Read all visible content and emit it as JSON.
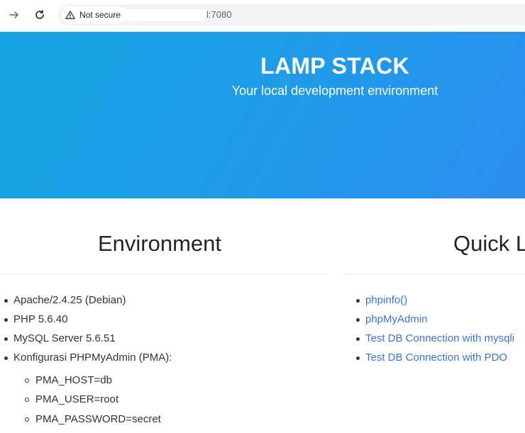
{
  "browser": {
    "security_label": "Not secure",
    "url_suffix": "l:7080",
    "icons": {
      "back": "arrow-right-icon",
      "reload": "reload-icon",
      "warning": "warning-triangle-icon"
    }
  },
  "hero": {
    "title": "LAMP STACK",
    "subtitle": "Your local development environment"
  },
  "environment": {
    "title": "Environment",
    "items": [
      "Apache/2.4.25 (Debian)",
      "PHP 5.6.40",
      "MySQL Server 5.6.51",
      "Konfigurasi PHPMyAdmin (PMA):"
    ],
    "sub_items": [
      "PMA_HOST=db",
      "PMA_USER=root",
      "PMA_PASSWORD=secret"
    ]
  },
  "quick_links": {
    "title": "Quick L",
    "items": [
      "phpinfo()",
      "phpMyAdmin",
      "Test DB Connection with mysqli",
      "Test DB Connection with PDO"
    ]
  },
  "colors": {
    "hero_start": "#15a3e3",
    "hero_end": "#2b8ff0",
    "link": "#3a73d6"
  }
}
